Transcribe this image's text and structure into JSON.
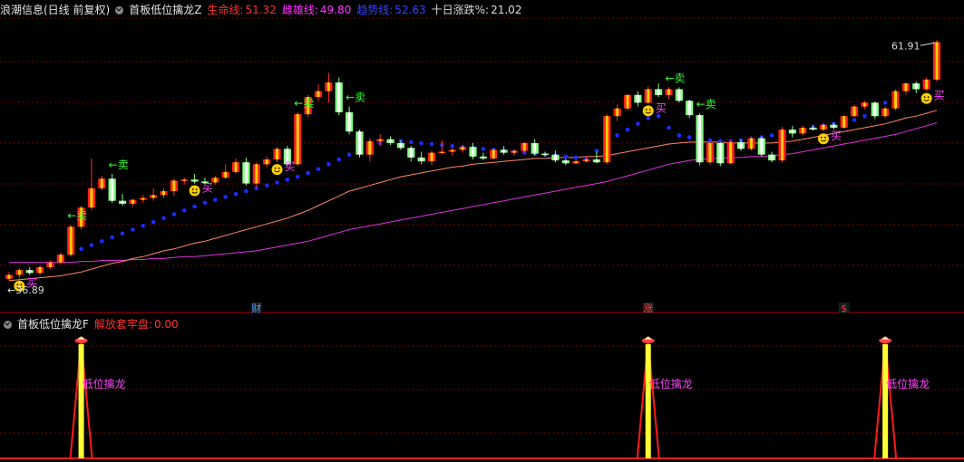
{
  "header": {
    "stock": "浪潮信息(日线 前复权)",
    "indicator": "首板低位擒龙Z",
    "items": [
      {
        "label": "生命线:",
        "value": "51.32",
        "color": "#ff3030"
      },
      {
        "label": "雌雄线:",
        "value": "49.80",
        "color": "#ff33ff"
      },
      {
        "label": "趋势线:",
        "value": "52.63",
        "color": "#3344ff"
      },
      {
        "label": "十日涨跌%:",
        "value": "21.02",
        "color": "#dddddd"
      }
    ]
  },
  "subheader": {
    "indicator": "首板低位擒龙F",
    "item_label": "解放套牢盘:",
    "item_value": "0.00"
  },
  "chart_data": {
    "type": "candlestick",
    "price_range": [
      35,
      64
    ],
    "max_label": "61.91",
    "min_label": "36.89",
    "candles": [
      [
        37.1,
        37.8,
        36.9,
        37.5
      ],
      [
        37.5,
        38.2,
        37.1,
        38.0
      ],
      [
        38.0,
        38.3,
        37.5,
        37.7
      ],
      [
        37.7,
        38.5,
        37.5,
        38.3
      ],
      [
        38.3,
        39.0,
        38.1,
        38.8
      ],
      [
        38.8,
        39.8,
        38.6,
        39.6
      ],
      [
        39.6,
        42.7,
        39.4,
        42.5
      ],
      [
        42.5,
        44.7,
        42.2,
        44.5
      ],
      [
        44.5,
        49.6,
        44.2,
        46.5
      ],
      [
        46.5,
        47.8,
        46.3,
        47.5
      ],
      [
        47.5,
        48.0,
        45.0,
        45.2
      ],
      [
        45.2,
        45.9,
        44.7,
        44.9
      ],
      [
        44.9,
        45.4,
        44.6,
        45.3
      ],
      [
        45.3,
        45.8,
        45.0,
        45.5
      ],
      [
        45.5,
        46.5,
        45.2,
        45.8
      ],
      [
        45.8,
        46.5,
        45.5,
        46.2
      ],
      [
        46.2,
        47.5,
        45.7,
        47.3
      ],
      [
        47.3,
        47.6,
        46.9,
        47.4
      ],
      [
        47.4,
        48.0,
        47.0,
        47.2
      ],
      [
        47.2,
        47.6,
        46.9,
        47.1
      ],
      [
        47.1,
        47.8,
        46.9,
        47.6
      ],
      [
        47.6,
        49.0,
        47.5,
        48.2
      ],
      [
        48.2,
        49.6,
        48.0,
        49.2
      ],
      [
        49.2,
        49.7,
        46.8,
        47.0
      ],
      [
        47.0,
        49.2,
        46.6,
        49.0
      ],
      [
        49.0,
        49.8,
        48.7,
        49.5
      ],
      [
        49.5,
        50.8,
        49.2,
        50.6
      ],
      [
        50.6,
        50.9,
        48.8,
        49.0
      ],
      [
        49.0,
        54.4,
        48.8,
        54.2
      ],
      [
        54.2,
        56.2,
        53.9,
        56.0
      ],
      [
        56.0,
        57.3,
        55.6,
        56.6
      ],
      [
        56.6,
        58.5,
        55.4,
        57.5
      ],
      [
        57.5,
        58.0,
        54.1,
        54.4
      ],
      [
        54.4,
        55.0,
        52.1,
        52.4
      ],
      [
        52.4,
        52.6,
        49.7,
        50.0
      ],
      [
        50.0,
        51.7,
        49.3,
        51.4
      ],
      [
        51.4,
        52.1,
        50.9,
        51.6
      ],
      [
        51.6,
        51.9,
        51.0,
        51.2
      ],
      [
        51.2,
        51.5,
        50.5,
        50.7
      ],
      [
        50.7,
        50.9,
        49.3,
        49.7
      ],
      [
        49.7,
        50.3,
        49.0,
        49.3
      ],
      [
        49.3,
        50.4,
        48.9,
        50.2
      ],
      [
        50.2,
        51.5,
        50.0,
        50.3
      ],
      [
        50.3,
        50.7,
        49.9,
        50.5
      ],
      [
        50.5,
        51.0,
        50.2,
        50.8
      ],
      [
        50.8,
        51.2,
        49.5,
        49.8
      ],
      [
        49.8,
        50.2,
        49.4,
        49.6
      ],
      [
        49.6,
        50.7,
        49.5,
        50.5
      ],
      [
        50.5,
        50.9,
        50.0,
        50.2
      ],
      [
        50.2,
        50.5,
        49.9,
        50.4
      ],
      [
        50.4,
        51.3,
        50.2,
        51.2
      ],
      [
        51.2,
        51.6,
        49.9,
        50.1
      ],
      [
        50.1,
        50.3,
        49.8,
        50.0
      ],
      [
        50.0,
        50.4,
        49.2,
        49.4
      ],
      [
        49.4,
        49.6,
        48.9,
        49.1
      ],
      [
        49.1,
        49.5,
        49.0,
        49.3
      ],
      [
        49.3,
        49.8,
        49.2,
        49.5
      ],
      [
        49.5,
        50.3,
        49.1,
        49.2
      ],
      [
        49.2,
        54.2,
        49.0,
        54.0
      ],
      [
        54.0,
        55.2,
        53.5,
        54.8
      ],
      [
        54.8,
        56.3,
        54.6,
        56.2
      ],
      [
        56.2,
        56.6,
        55.0,
        55.4
      ],
      [
        55.4,
        57.1,
        55.3,
        56.8
      ],
      [
        56.8,
        57.4,
        56.0,
        56.2
      ],
      [
        56.2,
        57.0,
        55.7,
        56.8
      ],
      [
        56.8,
        57.0,
        55.4,
        55.6
      ],
      [
        55.6,
        55.7,
        53.8,
        54.1
      ],
      [
        54.1,
        54.3,
        48.9,
        49.2
      ],
      [
        49.2,
        51.4,
        49.0,
        51.2
      ],
      [
        51.2,
        51.3,
        48.8,
        49.1
      ],
      [
        49.1,
        51.5,
        49.0,
        51.3
      ],
      [
        51.3,
        51.6,
        50.4,
        50.6
      ],
      [
        50.6,
        51.9,
        50.4,
        51.7
      ],
      [
        51.7,
        51.9,
        49.8,
        50.0
      ],
      [
        50.0,
        50.3,
        49.2,
        49.4
      ],
      [
        49.4,
        52.9,
        49.2,
        52.6
      ],
      [
        52.6,
        53.0,
        51.8,
        52.2
      ],
      [
        52.2,
        53.0,
        52.0,
        52.8
      ],
      [
        52.8,
        53.1,
        52.5,
        52.6
      ],
      [
        52.6,
        53.3,
        52.4,
        53.1
      ],
      [
        53.1,
        53.3,
        52.6,
        52.8
      ],
      [
        52.8,
        54.1,
        52.7,
        54.0
      ],
      [
        54.0,
        55.2,
        53.9,
        55.0
      ],
      [
        55.0,
        55.6,
        54.7,
        55.4
      ],
      [
        55.4,
        55.5,
        53.7,
        54.0
      ],
      [
        54.0,
        55.0,
        53.8,
        54.8
      ],
      [
        54.8,
        56.8,
        54.6,
        56.6
      ],
      [
        56.6,
        57.5,
        56.2,
        57.4
      ],
      [
        57.4,
        57.6,
        56.4,
        56.8
      ],
      [
        56.8,
        58.0,
        56.6,
        57.8
      ],
      [
        57.8,
        61.9,
        57.6,
        61.7
      ]
    ],
    "ma_life": [
      36.9,
      37.0,
      37.1,
      37.2,
      37.3,
      37.4,
      37.6,
      37.8,
      38.1,
      38.4,
      38.7,
      38.9,
      39.2,
      39.4,
      39.7,
      40.0,
      40.2,
      40.5,
      40.8,
      41.0,
      41.3,
      41.6,
      41.9,
      42.2,
      42.5,
      42.8,
      43.1,
      43.4,
      43.8,
      44.2,
      44.7,
      45.2,
      45.7,
      46.2,
      46.5,
      46.8,
      47.1,
      47.4,
      47.7,
      47.9,
      48.1,
      48.3,
      48.5,
      48.7,
      48.8,
      49.0,
      49.1,
      49.2,
      49.3,
      49.4,
      49.5,
      49.6,
      49.6,
      49.7,
      49.7,
      49.7,
      49.8,
      49.8,
      49.9,
      50.1,
      50.3,
      50.5,
      50.7,
      50.9,
      51.1,
      51.2,
      51.3,
      51.3,
      51.3,
      51.3,
      51.2,
      51.2,
      51.2,
      51.2,
      51.2,
      51.3,
      51.4,
      51.6,
      51.8,
      52.0,
      52.2,
      52.4,
      52.6,
      52.8,
      53.0,
      53.2,
      53.5,
      53.8,
      54.0,
      54.3,
      54.6
    ],
    "ma_male": [
      38.8,
      38.8,
      38.8,
      38.8,
      38.8,
      38.8,
      38.8,
      38.9,
      38.9,
      39.0,
      39.0,
      39.0,
      39.1,
      39.1,
      39.2,
      39.2,
      39.3,
      39.4,
      39.4,
      39.5,
      39.6,
      39.7,
      39.8,
      39.9,
      40.0,
      40.2,
      40.4,
      40.6,
      40.8,
      41.0,
      41.3,
      41.6,
      41.9,
      42.2,
      42.4,
      42.6,
      42.8,
      43.0,
      43.2,
      43.4,
      43.6,
      43.8,
      44.0,
      44.2,
      44.4,
      44.6,
      44.8,
      45.0,
      45.2,
      45.4,
      45.6,
      45.8,
      46.0,
      46.2,
      46.4,
      46.6,
      46.8,
      47.0,
      47.2,
      47.5,
      47.8,
      48.1,
      48.4,
      48.7,
      49.0,
      49.2,
      49.4,
      49.5,
      49.6,
      49.6,
      49.7,
      49.7,
      49.8,
      49.8,
      49.9,
      50.0,
      50.1,
      50.3,
      50.5,
      50.7,
      50.9,
      51.1,
      51.3,
      51.5,
      51.7,
      51.9,
      52.1,
      52.4,
      52.7,
      53.0,
      53.3
    ],
    "trend_dots_start": 7,
    "trend_dots": [
      40.2,
      40.6,
      41.0,
      41.4,
      41.8,
      42.2,
      42.6,
      43.0,
      43.4,
      43.8,
      44.2,
      44.6,
      45.0,
      45.3,
      45.6,
      45.9,
      46.2,
      46.5,
      46.8,
      47.1,
      47.4,
      47.7,
      48.1,
      48.5,
      49.0,
      49.5,
      50.0,
      50.5,
      51.0,
      51.2,
      51.4,
      51.4,
      51.3,
      51.2,
      51.1,
      51.0,
      50.9,
      50.8,
      50.7,
      50.6,
      50.5,
      50.4,
      50.3,
      50.2,
      50.1,
      50.0,
      49.9,
      49.8,
      49.7,
      49.6,
      50.4,
      51.2,
      52.0,
      52.6,
      53.2,
      53.8,
      54.0,
      52.8,
      52.0,
      51.8,
      51.6,
      51.5,
      51.4,
      51.4,
      51.5,
      51.6,
      51.8,
      52.0,
      52.2,
      52.4,
      52.6,
      52.8,
      53.0,
      53.2,
      53.4,
      53.6,
      54.0,
      54.8,
      55.4
    ],
    "sell_marks": [
      {
        "i": 6,
        "text": "←卖"
      },
      {
        "i": 10,
        "text": "←卖"
      },
      {
        "i": 28,
        "text": "←卖"
      },
      {
        "i": 33,
        "text": "←卖"
      },
      {
        "i": 64,
        "text": "←卖"
      },
      {
        "i": 67,
        "text": "←卖"
      }
    ],
    "buy_marks": [
      {
        "i": 1,
        "text": "买"
      },
      {
        "i": 18,
        "text": "买"
      },
      {
        "i": 26,
        "text": "买"
      },
      {
        "i": 62,
        "text": "买"
      },
      {
        "i": 79,
        "text": "买"
      },
      {
        "i": 89,
        "text": "买"
      }
    ],
    "event_markers": [
      {
        "i": 24,
        "text": "财",
        "color": "#5599ff"
      },
      {
        "i": 62,
        "text": "涨",
        "color": "#ff4444"
      },
      {
        "i": 81,
        "text": "$",
        "color": "#ff3333"
      }
    ],
    "signal_label": "低位擒龙",
    "signals": [
      7,
      62,
      85
    ]
  }
}
